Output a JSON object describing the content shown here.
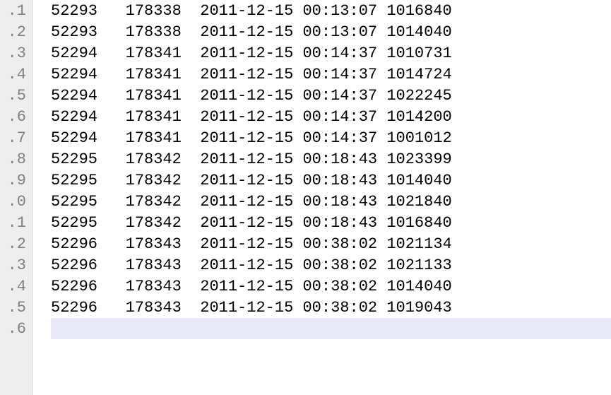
{
  "gutter_labels": [
    ".1",
    ".2",
    ".3",
    ".4",
    ".5",
    ".6",
    ".7",
    ".8",
    ".9",
    ".0",
    ".1",
    ".2",
    ".3",
    ".4",
    ".5",
    ".6"
  ],
  "rows": [
    {
      "c1": "52293",
      "c2": "178338",
      "c3": "2011-12-15",
      "c4": "00:13:07",
      "c5": "1016840"
    },
    {
      "c1": "52293",
      "c2": "178338",
      "c3": "2011-12-15",
      "c4": "00:13:07",
      "c5": "1014040"
    },
    {
      "c1": "52294",
      "c2": "178341",
      "c3": "2011-12-15",
      "c4": "00:14:37",
      "c5": "1010731"
    },
    {
      "c1": "52294",
      "c2": "178341",
      "c3": "2011-12-15",
      "c4": "00:14:37",
      "c5": "1014724"
    },
    {
      "c1": "52294",
      "c2": "178341",
      "c3": "2011-12-15",
      "c4": "00:14:37",
      "c5": "1022245"
    },
    {
      "c1": "52294",
      "c2": "178341",
      "c3": "2011-12-15",
      "c4": "00:14:37",
      "c5": "1014200"
    },
    {
      "c1": "52294",
      "c2": "178341",
      "c3": "2011-12-15",
      "c4": "00:14:37",
      "c5": "1001012"
    },
    {
      "c1": "52295",
      "c2": "178342",
      "c3": "2011-12-15",
      "c4": "00:18:43",
      "c5": "1023399"
    },
    {
      "c1": "52295",
      "c2": "178342",
      "c3": "2011-12-15",
      "c4": "00:18:43",
      "c5": "1014040"
    },
    {
      "c1": "52295",
      "c2": "178342",
      "c3": "2011-12-15",
      "c4": "00:18:43",
      "c5": "1021840"
    },
    {
      "c1": "52295",
      "c2": "178342",
      "c3": "2011-12-15",
      "c4": "00:18:43",
      "c5": "1016840"
    },
    {
      "c1": "52296",
      "c2": "178343",
      "c3": "2011-12-15",
      "c4": "00:38:02",
      "c5": "1021134"
    },
    {
      "c1": "52296",
      "c2": "178343",
      "c3": "2011-12-15",
      "c4": "00:38:02",
      "c5": "1021133"
    },
    {
      "c1": "52296",
      "c2": "178343",
      "c3": "2011-12-15",
      "c4": "00:38:02",
      "c5": "1014040"
    },
    {
      "c1": "52296",
      "c2": "178343",
      "c3": "2011-12-15",
      "c4": "00:38:02",
      "c5": "1019043"
    }
  ],
  "current_line_index": 15
}
